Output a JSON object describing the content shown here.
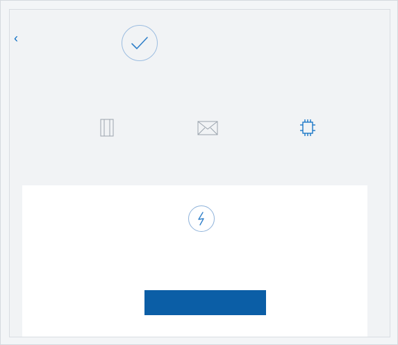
{
  "header": {
    "back_glyph": "‹",
    "title": ""
  },
  "intro": {
    "line1": "",
    "line2": ""
  },
  "options": [
    {
      "label": "",
      "icon": "document-frame-icon"
    },
    {
      "label": "",
      "icon": "envelope-icon"
    },
    {
      "label": "",
      "icon": "chip-icon"
    }
  ],
  "card": {
    "text": "",
    "button_label": ""
  },
  "colors": {
    "accent": "#0b5ea6",
    "link": "#0d6fc4"
  }
}
